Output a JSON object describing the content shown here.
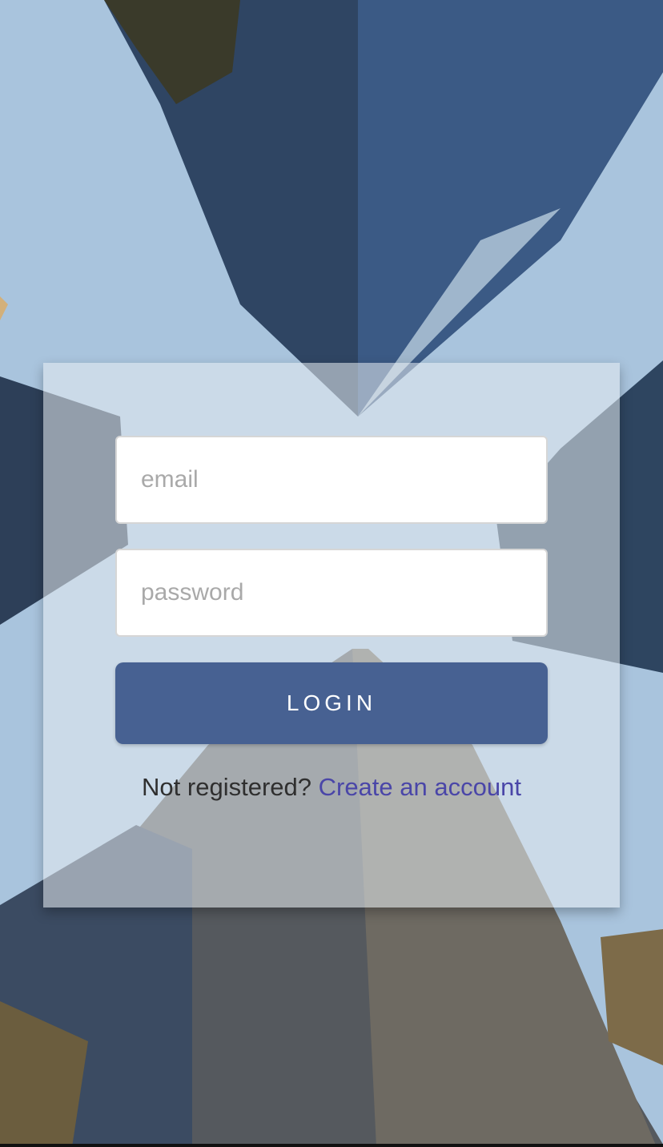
{
  "login": {
    "email_placeholder": "email",
    "password_placeholder": "password",
    "button_label": "LOGIN",
    "register_prompt": "Not registered?",
    "register_link": "Create an account"
  },
  "colors": {
    "button": "#476192",
    "link": "#4a46a8"
  }
}
